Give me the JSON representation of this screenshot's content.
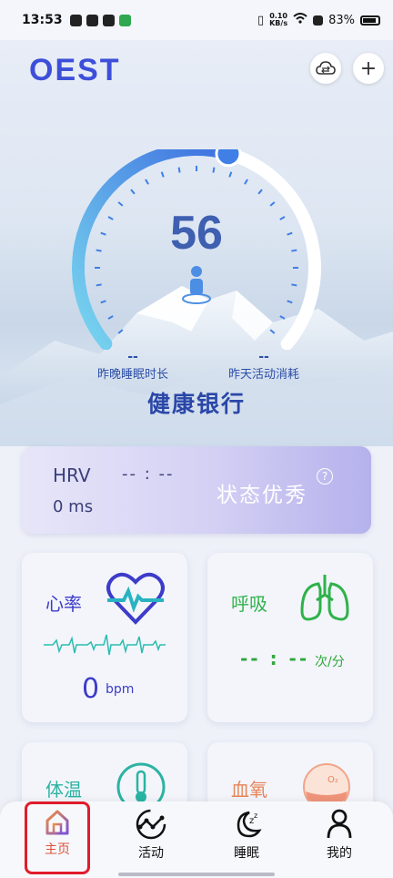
{
  "status_bar": {
    "time": "13:53",
    "net_speed_top": "0.10",
    "net_speed_bottom": "KB/s",
    "battery": "83%"
  },
  "header": {
    "logo": "OEST",
    "sync_icon": "cloud-sync-icon",
    "add_label": "+"
  },
  "gauge": {
    "score": "56",
    "score_fraction": 0.56
  },
  "stats": {
    "sleep_value": "--",
    "sleep_label": "昨晚睡眠时长",
    "activity_value": "--",
    "activity_label": "昨天活动消耗"
  },
  "bank_title": "健康银行",
  "hrv": {
    "label": "HRV",
    "time": "-- : --",
    "value": "0 ms",
    "state": "状态优秀",
    "help": "?"
  },
  "tiles": {
    "heart": {
      "title": "心率",
      "value": "0",
      "unit": "bpm"
    },
    "breath": {
      "title": "呼吸",
      "value": "-- : --",
      "unit": "次/分"
    },
    "temp": {
      "title": "体温"
    },
    "oxygen": {
      "title": "血氧",
      "badge": "O₂"
    }
  },
  "nav": [
    {
      "label": "主页",
      "icon": "home-icon"
    },
    {
      "label": "活动",
      "icon": "activity-icon"
    },
    {
      "label": "睡眠",
      "icon": "sleep-icon"
    },
    {
      "label": "我的",
      "icon": "profile-icon"
    }
  ],
  "colors": {
    "brand": "#3d4fd8",
    "heart": "#3d3cc9",
    "breath": "#2fb24a",
    "temp": "#2bb3a3",
    "oxygen": "#e8845a",
    "active_nav": "#e2503a"
  }
}
